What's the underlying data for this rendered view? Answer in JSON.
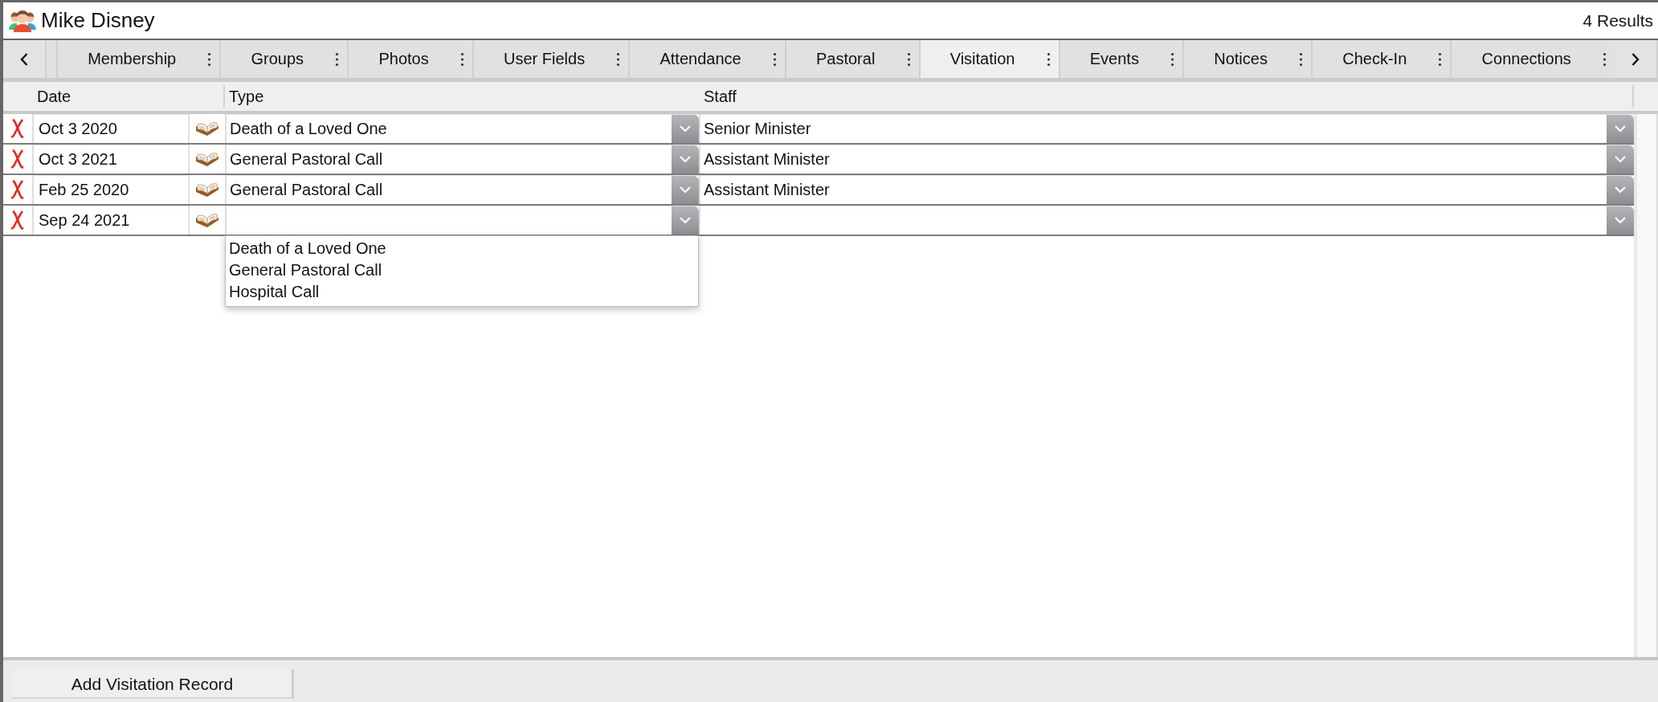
{
  "header": {
    "name": "Mike Disney",
    "results": "4 Results"
  },
  "tabs": [
    {
      "label": "Membership",
      "selected": false
    },
    {
      "label": "Groups",
      "selected": false
    },
    {
      "label": "Photos",
      "selected": false
    },
    {
      "label": "User Fields",
      "selected": false
    },
    {
      "label": "Attendance",
      "selected": false
    },
    {
      "label": "Pastoral",
      "selected": false
    },
    {
      "label": "Visitation",
      "selected": true
    },
    {
      "label": "Events",
      "selected": false
    },
    {
      "label": "Notices",
      "selected": false
    },
    {
      "label": "Check-In",
      "selected": false
    },
    {
      "label": "Connections",
      "selected": false
    }
  ],
  "table": {
    "columns": [
      "Date",
      "Type",
      "Staff"
    ],
    "rows": [
      {
        "date": "Oct 3 2020",
        "type": "Death of a Loved One",
        "staff": "Senior Minister"
      },
      {
        "date": "Oct 3 2021",
        "type": "General Pastoral Call",
        "staff": "Assistant Minister"
      },
      {
        "date": "Feb 25 2020",
        "type": "General Pastoral Call",
        "staff": "Assistant Minister"
      },
      {
        "date": "Sep 24 2021",
        "type_menu_options": [
          "Death of a Loved One",
          "General Pastoral Call",
          "Hospital Call"
        ]
      }
    ]
  },
  "footer": {
    "add_button": "Add Visitation Record"
  }
}
